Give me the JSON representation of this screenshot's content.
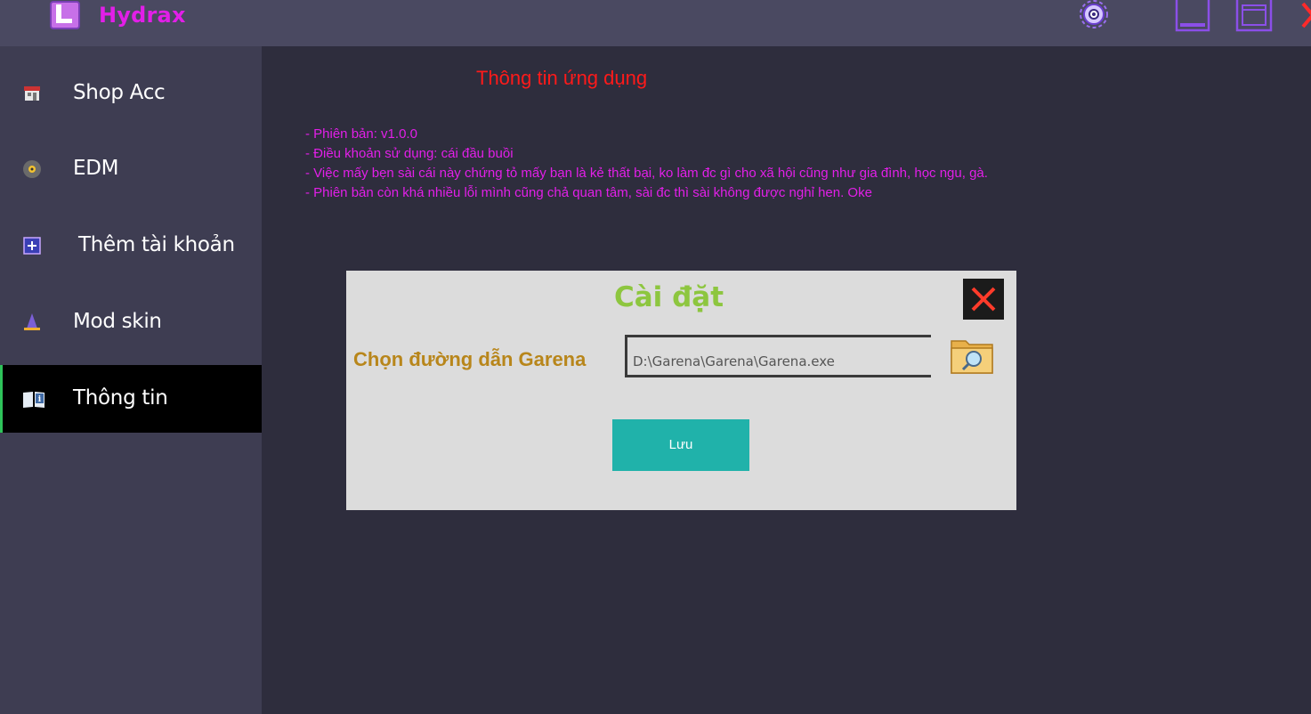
{
  "app": {
    "title": "Hydrax",
    "accent": "#e21fe8"
  },
  "titlebar": {
    "icons": [
      "logo-icon",
      "settings-icon",
      "minimize-icon",
      "maximize-icon",
      "close-icon"
    ]
  },
  "sidebar": {
    "items": [
      {
        "label": "Shop Acc",
        "icon": "shop-icon",
        "active": false
      },
      {
        "label": "EDM",
        "icon": "music-disc-icon",
        "active": false
      },
      {
        "label": "Thêm tài khoản",
        "icon": "add-account-icon",
        "active": false
      },
      {
        "label": "Mod skin",
        "icon": "wizard-hat-icon",
        "active": false
      },
      {
        "label": "Thông tin",
        "icon": "info-book-icon",
        "active": true
      }
    ]
  },
  "main": {
    "title": "Thông tin ứng dụng",
    "lines": [
      "- Phiên bản: v1.0.0",
      "- Điều khoản sử dụng: cái đầu buồi",
      "- Việc mấy bẹn sài cái này chứng tỏ mấy bạn là kẻ thất bại, ko làm đc gì cho xã hội cũng như gia đình, học ngu, gà.",
      "- Phiên bản còn khá nhiều lỗi mình cũng chả quan tâm, sài đc thì sài không được nghỉ hen. Oke"
    ]
  },
  "dialog": {
    "title": "Cài đặt",
    "label": "Chọn đường dẫn Garena",
    "path_value": "D:\\Garena\\Garena\\Garena.exe",
    "save_label": "Lưu",
    "colors": {
      "title": "#8dc63f",
      "label": "#b8861b",
      "save": "#20b2aa"
    }
  }
}
